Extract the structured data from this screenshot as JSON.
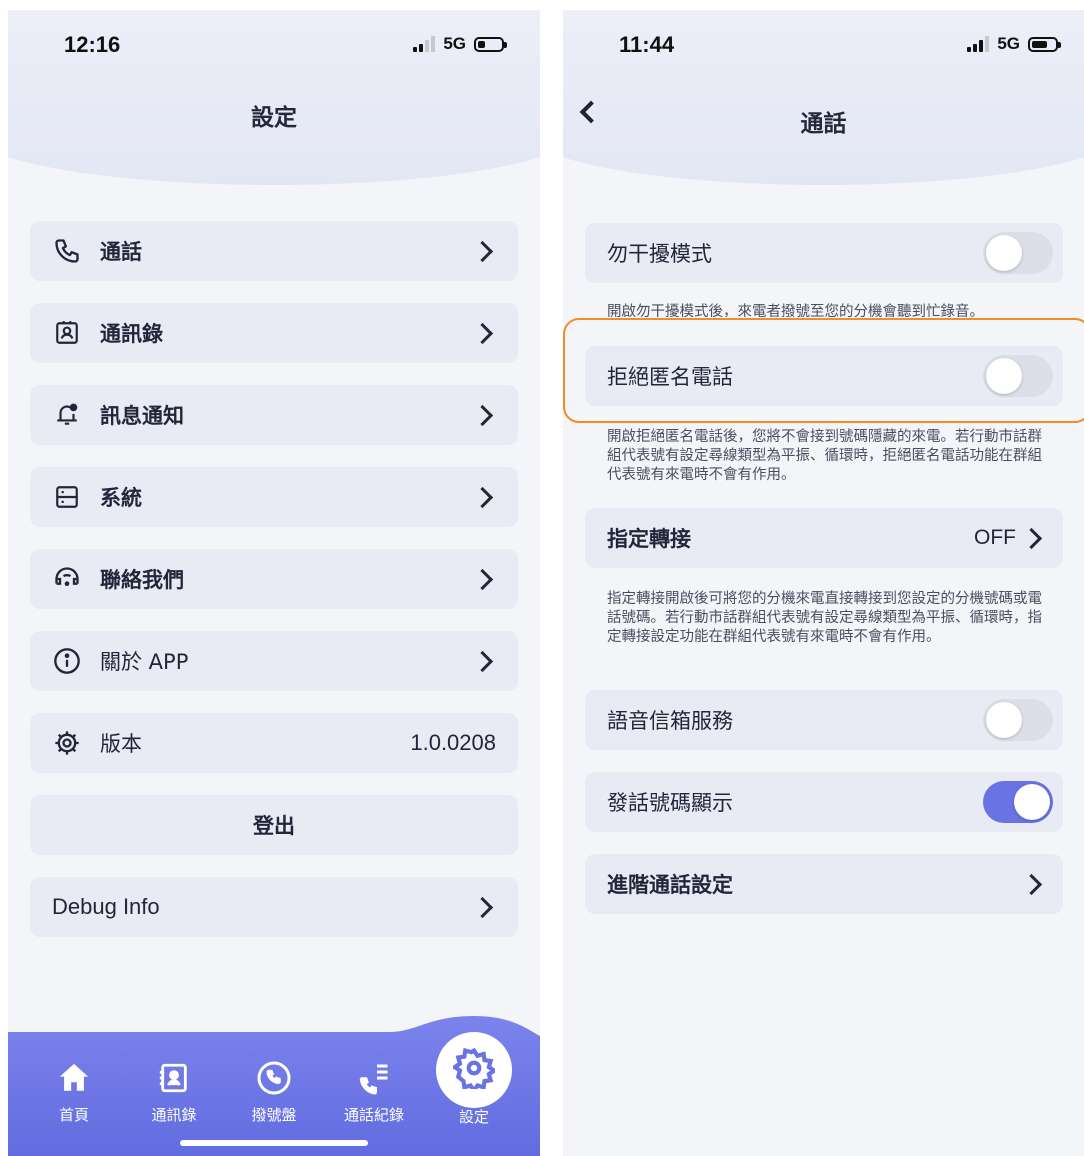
{
  "left": {
    "status": {
      "time": "12:16",
      "network": "5G"
    },
    "title": "設定",
    "menu": [
      {
        "label": "通話",
        "icon": "phone-icon"
      },
      {
        "label": "通訊錄",
        "icon": "contact-card-icon"
      },
      {
        "label": "訊息通知",
        "icon": "bell-icon"
      },
      {
        "label": "系統",
        "icon": "server-icon"
      },
      {
        "label": "聯絡我們",
        "icon": "headset-icon"
      },
      {
        "label": "關於 APP",
        "icon": "info-icon"
      }
    ],
    "version": {
      "label": "版本",
      "value": "1.0.0208",
      "icon": "gear-icon"
    },
    "logout": "登出",
    "debug": "Debug Info",
    "tabs": [
      {
        "label": "首頁",
        "icon": "home-icon"
      },
      {
        "label": "通訊錄",
        "icon": "contacts-icon"
      },
      {
        "label": "撥號盤",
        "icon": "dialpad-icon"
      },
      {
        "label": "通話紀錄",
        "icon": "call-log-icon"
      },
      {
        "label": "設定",
        "icon": "settings-icon",
        "active": true
      }
    ],
    "colors": {
      "tabbar": "#6a73e3",
      "accent": "#6a73e3"
    }
  },
  "right": {
    "status": {
      "time": "11:44",
      "network": "5G"
    },
    "title": "通話",
    "dnd": {
      "label": "勿干擾模式",
      "on": false,
      "desc": "開啟勿干擾模式後，來電者撥號至您的分機會聽到忙錄音。"
    },
    "reject_anon": {
      "label": "拒絕匿名電話",
      "on": false,
      "desc": "開啟拒絕匿名電話後，您將不會接到號碼隱藏的來電。若行動市話群組代表號有設定尋線類型為平振、循環時，拒絕匿名電話功能在群組代表號有來電時不會有作用。"
    },
    "forward": {
      "label": "指定轉接",
      "value": "OFF",
      "desc": "指定轉接開啟後可將您的分機來電直接轉接到您設定的分機號碼或電話號碼。若行動市話群組代表號有設定尋線類型為平振、循環時，指定轉接設定功能在群組代表號有來電時不會有作用。"
    },
    "voicemail": {
      "label": "語音信箱服務",
      "on": false
    },
    "caller_id": {
      "label": "發話號碼顯示",
      "on": true
    },
    "advanced": {
      "label": "進階通話設定"
    },
    "colors": {
      "toggle_on": "#6a73e3",
      "highlight": "#f28c28"
    }
  }
}
